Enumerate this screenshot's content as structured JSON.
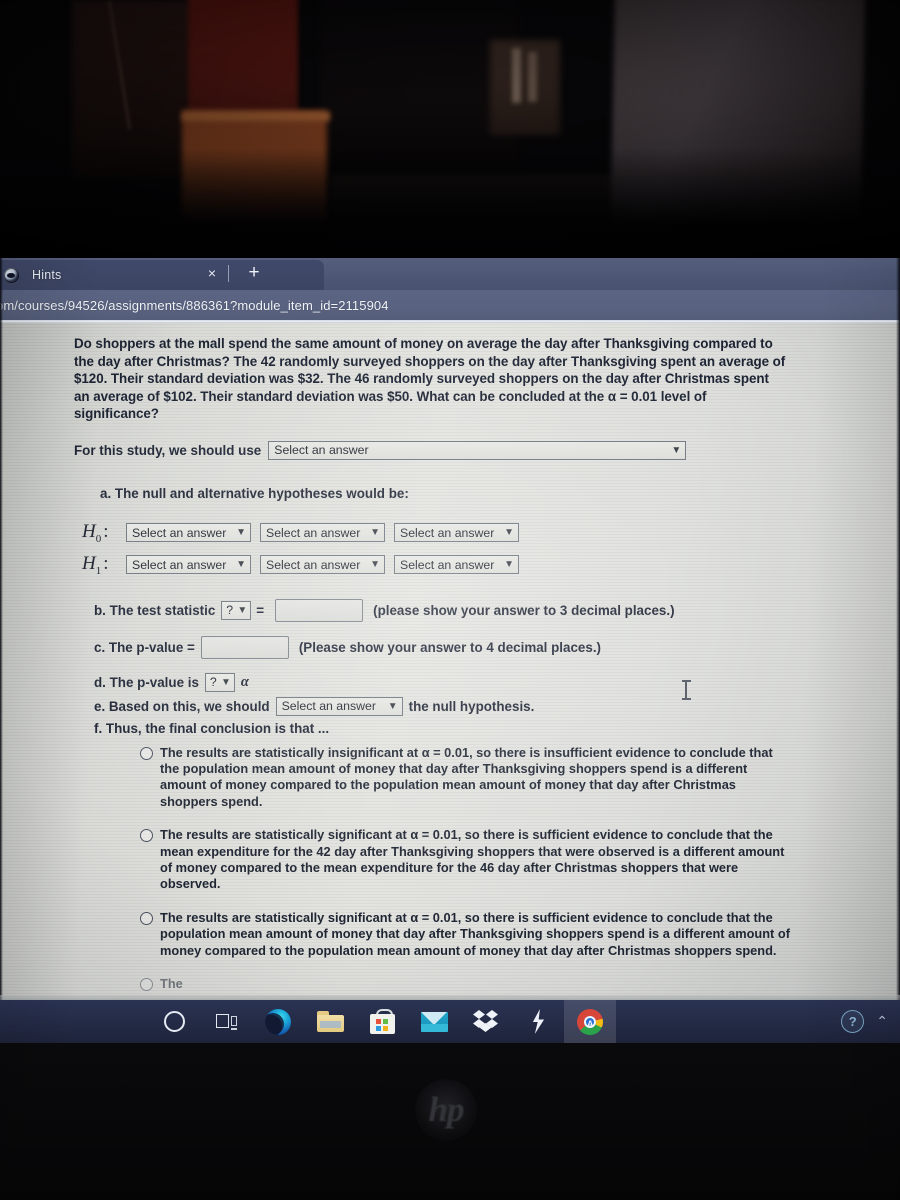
{
  "browser": {
    "tab": {
      "favicon": "globe-icon",
      "title": "Hints",
      "close_label": "×",
      "new_tab_label": "+"
    },
    "address_bar": {
      "url": "om/courses/94526/assignments/886361?module_item_id=2115904"
    }
  },
  "problem": {
    "statement": "Do shoppers at the mall spend the same amount of money on average the day after Thanksgiving compared to the day after Christmas? The 42 randomly surveyed shoppers on the day after Thanksgiving spent an average of $120. Their standard deviation was $32. The 46 randomly surveyed shoppers on the day after Christmas spent an average of $102. Their standard deviation was $50. What can be concluded at the α = 0.01 level of significance?",
    "study_prompt": "For this study, we should use",
    "study_select_value": "Select an answer",
    "part_a_label": "a. The null and alternative hypotheses would be:",
    "hypotheses": [
      {
        "label": "H",
        "sub": "0",
        "colon": ":",
        "selects": [
          "Select an answer",
          "Select an answer",
          "Select an answer"
        ]
      },
      {
        "label": "H",
        "sub": "1",
        "colon": ":",
        "selects": [
          "Select an answer",
          "Select an answer",
          "Select an answer"
        ]
      }
    ],
    "part_b": {
      "prefix": "b. The test statistic",
      "select_value": "?",
      "equals": "=",
      "input_value": "",
      "hint": "(please show your answer to 3 decimal places.)"
    },
    "part_c": {
      "prefix": "c. The p-value =",
      "input_value": "",
      "hint": "(Please show your answer to 4 decimal places.)"
    },
    "part_d": {
      "prefix": "d. The p-value is",
      "select_value": "?",
      "alpha": "α"
    },
    "part_e": {
      "prefix": "e. Based on this, we should",
      "select_value": "Select an answer",
      "suffix": "the null hypothesis."
    },
    "part_f": {
      "prefix": "f. Thus, the final conclusion is that ..."
    },
    "options": [
      "The results are statistically insignificant at α = 0.01, so there is insufficient evidence to conclude that the population mean amount of money that day after Thanksgiving shoppers spend is a different amount of money compared to the population mean amount of money that day after Christmas shoppers spend.",
      "The results are statistically significant at α = 0.01, so there is sufficient evidence to conclude that the mean expenditure for the 42 day after Thanksgiving shoppers that were observed is a different amount of money compared to the mean expenditure for the 46 day after Christmas shoppers that were observed.",
      "The results are statistically significant at α = 0.01, so there is sufficient evidence to conclude that the population mean amount of money that day after Thanksgiving shoppers spend is a different amount of money compared to the population mean amount of money that day after Christmas shoppers spend.",
      "The"
    ]
  },
  "taskbar": {
    "items": [
      {
        "name": "cortana-icon",
        "label": "Cortana"
      },
      {
        "name": "task-view-icon",
        "label": "Task View"
      },
      {
        "name": "edge-icon",
        "label": "Microsoft Edge"
      },
      {
        "name": "file-explorer-icon",
        "label": "File Explorer"
      },
      {
        "name": "microsoft-store-icon",
        "label": "Microsoft Store"
      },
      {
        "name": "mail-icon",
        "label": "Mail"
      },
      {
        "name": "dropbox-icon",
        "label": "Dropbox"
      },
      {
        "name": "bolt-icon",
        "label": "Lightning App"
      },
      {
        "name": "chrome-icon",
        "label": "Google Chrome",
        "badge": "A",
        "active": true
      }
    ],
    "tray": {
      "help_label": "?",
      "chevron_label": "⌃"
    }
  },
  "monitor": {
    "brand_logo": "hp"
  },
  "colors": {
    "chrome_tabstrip": "#4e5877",
    "chrome_omnibar": "#59627f",
    "page_bg": "#dddedb",
    "text": "#1b2232",
    "taskbar": "#252c48",
    "select_border": "#6e7580"
  }
}
